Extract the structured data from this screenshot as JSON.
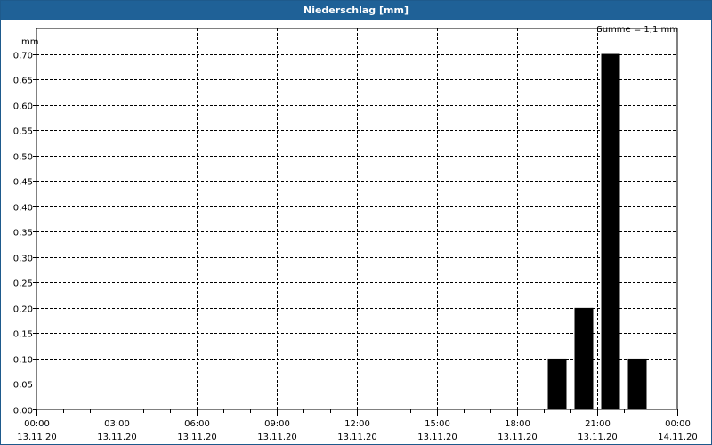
{
  "window": {
    "title": "Niederschlag [mm]"
  },
  "chart_data": {
    "type": "bar",
    "title": "Niederschlag [mm]",
    "ylabel": "mm",
    "sum_label": "Summe = 1,1 mm",
    "ylim": [
      0,
      0.75
    ],
    "y_ticks": [
      "0,00",
      "0,05",
      "0,10",
      "0,15",
      "0,20",
      "0,25",
      "0,30",
      "0,35",
      "0,40",
      "0,45",
      "0,50",
      "0,55",
      "0,60",
      "0,65",
      "0,70"
    ],
    "y_tick_values": [
      0,
      0.05,
      0.1,
      0.15,
      0.2,
      0.25,
      0.3,
      0.35,
      0.4,
      0.45,
      0.5,
      0.55,
      0.6,
      0.65,
      0.7
    ],
    "x_ticks": [
      {
        "hour": 0,
        "time": "00:00",
        "date": "13.11.20"
      },
      {
        "hour": 3,
        "time": "03:00",
        "date": "13.11.20"
      },
      {
        "hour": 6,
        "time": "06:00",
        "date": "13.11.20"
      },
      {
        "hour": 9,
        "time": "09:00",
        "date": "13.11.20"
      },
      {
        "hour": 12,
        "time": "12:00",
        "date": "13.11.20"
      },
      {
        "hour": 15,
        "time": "15:00",
        "date": "13.11.20"
      },
      {
        "hour": 18,
        "time": "18:00",
        "date": "13.11.20"
      },
      {
        "hour": 21,
        "time": "21:00",
        "date": "13.11.20"
      },
      {
        "hour": 24,
        "time": "00:00",
        "date": "14.11.20"
      }
    ],
    "xlim": [
      0,
      24
    ],
    "bars": [
      {
        "hour": 19.5,
        "value": 0.1
      },
      {
        "hour": 20.5,
        "value": 0.2
      },
      {
        "hour": 21.5,
        "value": 0.7
      },
      {
        "hour": 22.5,
        "value": 0.1
      }
    ],
    "grid": true,
    "colors": {
      "bar": "#000000",
      "titlebar": "#1f6197",
      "grid": "#000000"
    }
  }
}
